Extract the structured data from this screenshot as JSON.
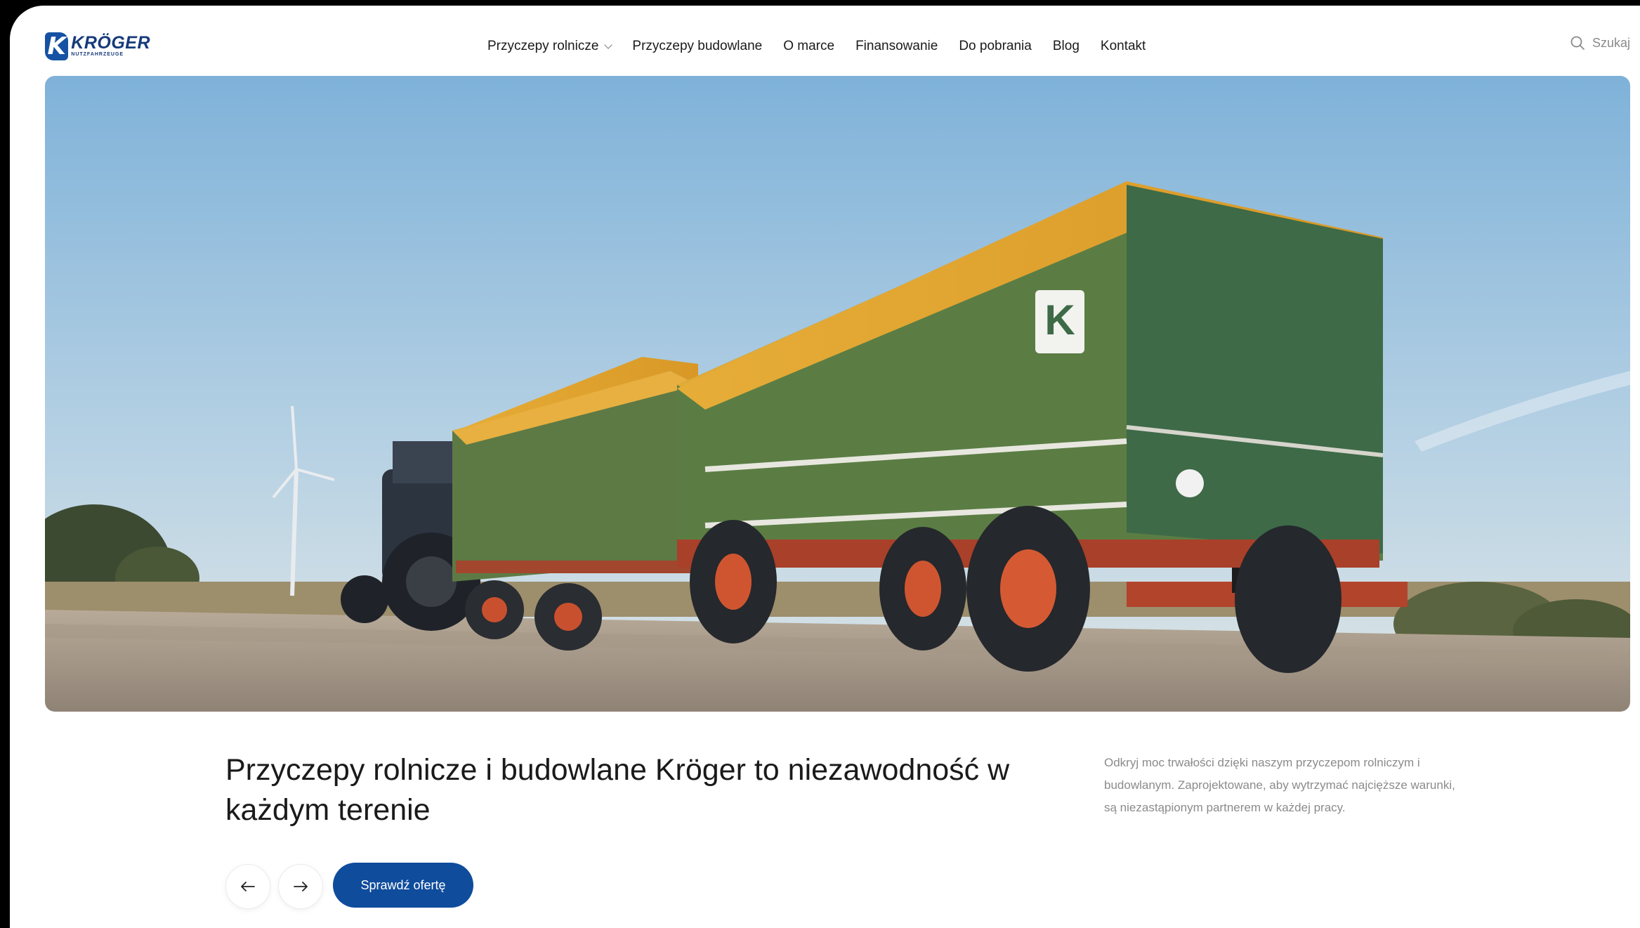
{
  "header": {
    "logo": {
      "name": "KRÖGER",
      "sub": "NUTZFAHRZEUGE",
      "mark": "K"
    },
    "nav": [
      {
        "label": "Przyczepy rolnicze",
        "has_dropdown": true
      },
      {
        "label": "Przyczepy budowlane"
      },
      {
        "label": "O marce"
      },
      {
        "label": "Finansowanie"
      },
      {
        "label": "Do pobrania"
      },
      {
        "label": "Blog"
      },
      {
        "label": "Kontakt"
      }
    ],
    "search": {
      "label": "Szukaj",
      "icon": "search-icon"
    }
  },
  "hero": {
    "headline": "Przyczepy rolnicze i budowlane Kröger to niezawodność w każdym terenie",
    "description": "Odkryj moc trwałości dzięki naszym przyczepom rolniczym i budowlanym. Zaprojektowane, aby wytrzymać najcięższe warunki, są niezastąpionym partnerem w każdej pracy.",
    "prev_icon": "arrow-left-icon",
    "next_icon": "arrow-right-icon",
    "cta": "Sprawdź ofertę"
  },
  "colors": {
    "brand_blue": "#0f4c9c",
    "tarp_yellow": "#e3a934",
    "trailer_green": "#4d6a3a"
  }
}
